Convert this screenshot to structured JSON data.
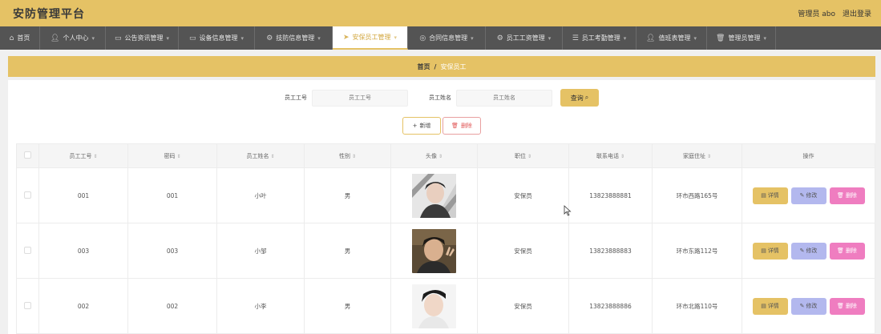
{
  "app": {
    "title": "安防管理平台"
  },
  "header": {
    "user_label": "管理员 abo",
    "logout_label": "退出登录"
  },
  "nav": {
    "items": [
      {
        "label": "首页",
        "icon": "home-icon",
        "active": false,
        "has_dropdown": false
      },
      {
        "label": "个人中心",
        "icon": "user-icon",
        "active": false,
        "has_dropdown": true
      },
      {
        "label": "公告资讯管理",
        "icon": "monitor-icon",
        "active": false,
        "has_dropdown": true
      },
      {
        "label": "设备信息管理",
        "icon": "monitor-icon",
        "active": false,
        "has_dropdown": true
      },
      {
        "label": "技防信息管理",
        "icon": "gear-icon",
        "active": false,
        "has_dropdown": true
      },
      {
        "label": "安保员工管理",
        "icon": "send-icon",
        "active": true,
        "has_dropdown": true
      },
      {
        "label": "合同信息管理",
        "icon": "compass-icon",
        "active": false,
        "has_dropdown": true
      },
      {
        "label": "员工工资管理",
        "icon": "gear-icon",
        "active": false,
        "has_dropdown": true
      },
      {
        "label": "员工考勤管理",
        "icon": "list-icon",
        "active": false,
        "has_dropdown": true
      },
      {
        "label": "值班表管理",
        "icon": "user-icon",
        "active": false,
        "has_dropdown": true
      },
      {
        "label": "管理员管理",
        "icon": "trash-icon",
        "active": false,
        "has_dropdown": true
      }
    ]
  },
  "breadcrumb": {
    "home": "首页",
    "separator": "/",
    "current": "安保员工"
  },
  "search": {
    "field1_label": "员工工号",
    "field1_placeholder": "员工工号",
    "field2_label": "员工姓名",
    "field2_placeholder": "员工姓名",
    "query_label": "查询"
  },
  "actions": {
    "add_label": "新增",
    "delete_label": "删除"
  },
  "table": {
    "columns": [
      "员工工号",
      "密码",
      "员工姓名",
      "性别",
      "头像",
      "职位",
      "联系电话",
      "家庭住址",
      "操作"
    ],
    "rows": [
      {
        "id": "001",
        "password": "001",
        "name": "小叶",
        "gender": "男",
        "position": "安保员",
        "phone": "13823888881",
        "address": "环市西路165号"
      },
      {
        "id": "003",
        "password": "003",
        "name": "小邹",
        "gender": "男",
        "position": "安保员",
        "phone": "13823888883",
        "address": "环市东路112号"
      },
      {
        "id": "002",
        "password": "002",
        "name": "小李",
        "gender": "男",
        "position": "安保员",
        "phone": "13823888886",
        "address": "环市北路110号"
      }
    ],
    "row_actions": {
      "detail": "详情",
      "edit": "修改",
      "remove": "删除"
    }
  },
  "colors": {
    "accent": "#e5c265",
    "nav_bg": "#545454",
    "edit_btn": "#b3b8ee",
    "delete_btn": "#ef7dc0"
  }
}
